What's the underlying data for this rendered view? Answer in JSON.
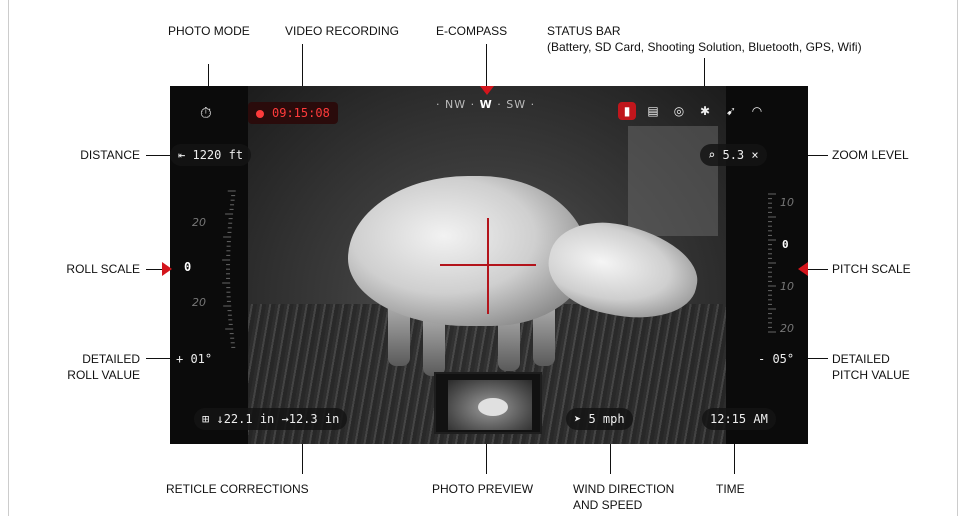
{
  "callouts": {
    "photo_mode": "PHOTO MODE",
    "video_recording": "VIDEO RECORDING",
    "e_compass": "E-COMPASS",
    "status_bar": "STATUS BAR",
    "status_bar_detail": "(Battery, SD Card, Shooting Solution, Bluetooth, GPS, Wifi)",
    "distance": "DISTANCE",
    "zoom_level": "ZOOM LEVEL",
    "roll_scale": "ROLL SCALE",
    "pitch_scale": "PITCH SCALE",
    "detailed_roll_value_1": "DETAILED",
    "detailed_roll_value_2": "ROLL VALUE",
    "detailed_pitch_value_1": "DETAILED",
    "detailed_pitch_value_2": "PITCH VALUE",
    "reticle_corrections": "RETICLE CORRECTIONS",
    "photo_preview": "PHOTO PREVIEW",
    "wind_direction_1": "WIND DIRECTION",
    "wind_direction_2": "AND SPEED",
    "time": "TIME"
  },
  "osd": {
    "recording_time": "09:15:08",
    "compass_left": "· NW ·",
    "compass_center": "W",
    "compass_right": "· SW ·",
    "distance": "1220 ft",
    "zoom": "5.3 ×",
    "roll_value": "0",
    "roll_scale_upper": "20",
    "roll_scale_lower": "20",
    "detailed_roll": "+ 01°",
    "pitch_scale_labels": [
      "10",
      "0",
      "10",
      "20"
    ],
    "detailed_pitch": "- 05°",
    "reticle_corrections": "↓22.1 in  →12.3 in",
    "wind": "5 mph",
    "time": "12:15 AM"
  },
  "icons": {
    "accent_color": "#c0161c"
  }
}
